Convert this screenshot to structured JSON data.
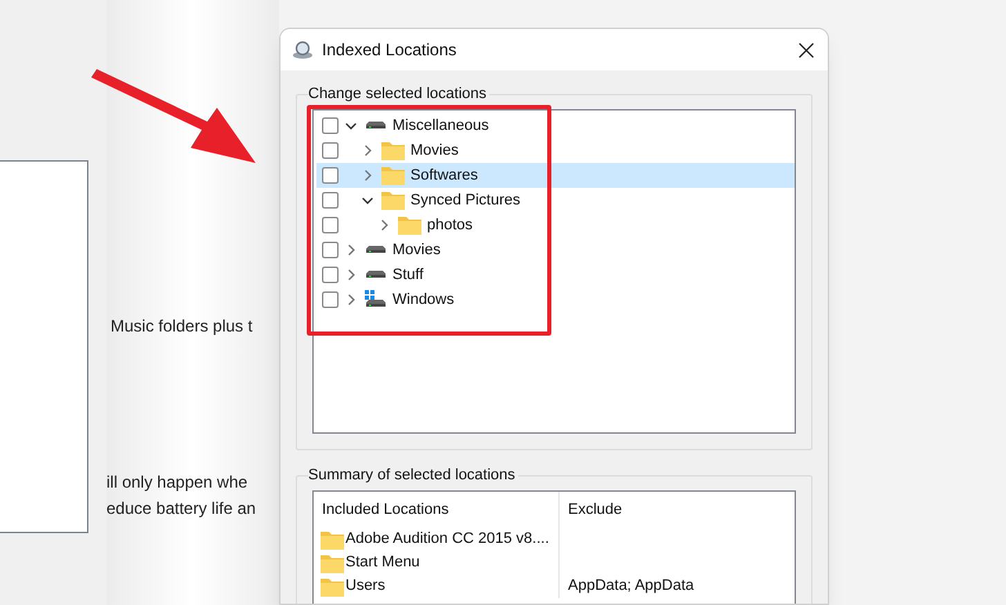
{
  "background_texts": [
    "Music folders plus t",
    "ill only happen whe",
    "educe battery life an"
  ],
  "dialog": {
    "title": "Indexed Locations",
    "locations_group": {
      "label": "Change selected locations",
      "tree": [
        {
          "label": "Miscellaneous",
          "kind": "drive",
          "checked": false,
          "expanded": true,
          "selected": false,
          "children": [
            {
              "label": "Movies",
              "kind": "folder",
              "checked": false,
              "expanded": false,
              "selected": false
            },
            {
              "label": "Softwares",
              "kind": "folder",
              "checked": false,
              "expanded": false,
              "selected": true
            },
            {
              "label": "Synced Pictures",
              "kind": "folder",
              "checked": false,
              "expanded": true,
              "selected": false,
              "children": [
                {
                  "label": "photos",
                  "kind": "folder",
                  "checked": false,
                  "expanded": false,
                  "selected": false
                }
              ]
            }
          ]
        },
        {
          "label": "Movies",
          "kind": "drive",
          "checked": false,
          "expanded": false,
          "selected": false
        },
        {
          "label": "Stuff",
          "kind": "drive",
          "checked": false,
          "expanded": false,
          "selected": false
        },
        {
          "label": "Windows",
          "kind": "system-drive",
          "checked": false,
          "expanded": false,
          "selected": false
        }
      ]
    },
    "summary_group": {
      "label": "Summary of selected locations",
      "columns": [
        "Included Locations",
        "Exclude"
      ],
      "rows": [
        {
          "included": "Adobe Audition CC 2015 v8....",
          "exclude": ""
        },
        {
          "included": "Start Menu",
          "exclude": ""
        },
        {
          "included": "Users",
          "exclude": "AppData; AppData"
        }
      ]
    }
  }
}
